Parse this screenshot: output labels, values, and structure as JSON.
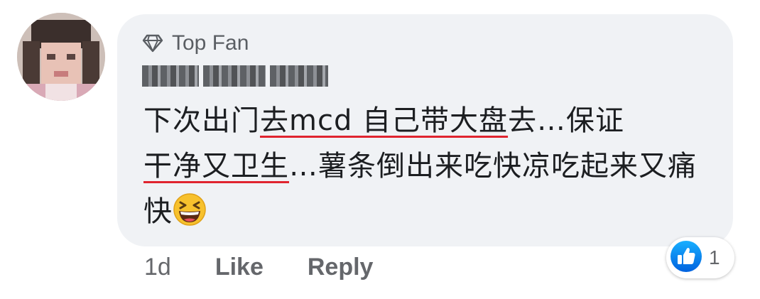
{
  "comment": {
    "badge_label": "Top Fan",
    "badge_icon": "diamond-icon",
    "author_name_obscured": "blurred",
    "text_parts": [
      {
        "text": "下次出门",
        "underline": false
      },
      {
        "text": "去mcd 自己带大盘",
        "underline": true
      },
      {
        "text": "去…保证",
        "underline": false
      },
      {
        "text": "干净又卫生",
        "underline": true
      },
      {
        "text": "…薯条倒出来吃快凉吃起来又痛快",
        "underline": false
      }
    ],
    "emoji": "laughing-emoji",
    "time": "1d",
    "like_label": "Like",
    "reply_label": "Reply",
    "reaction_count": "1",
    "reaction_icon": "thumbs-up-icon"
  },
  "colors": {
    "bubble": "#f0f2f5",
    "underline": "#e0242f",
    "like_blue": "#1877f2",
    "meta_gray": "#65676b"
  }
}
